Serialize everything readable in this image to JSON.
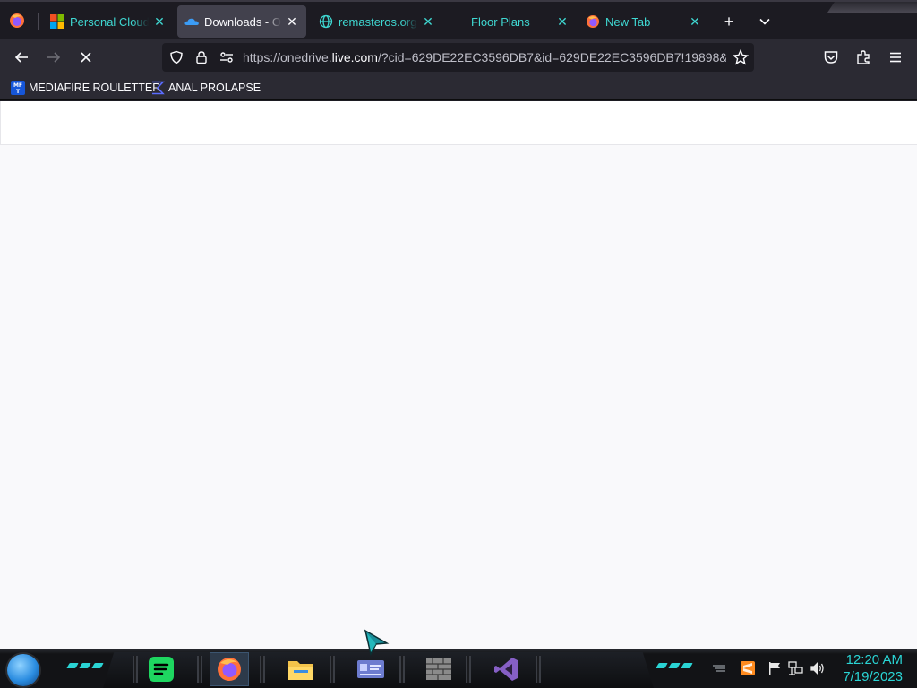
{
  "browser": {
    "tabs": [
      {
        "label": "Personal Cloud Storage",
        "icon": "microsoft-icon",
        "active": false
      },
      {
        "label": "Downloads - OneDrive",
        "icon": "onedrive-icon",
        "active": true
      },
      {
        "label": "remasteros.org/n",
        "icon": "globe-icon",
        "active": false
      },
      {
        "label": "Floor Plans",
        "icon": "none",
        "active": false
      },
      {
        "label": "New Tab",
        "icon": "firefox-icon",
        "active": false
      }
    ],
    "close_glyph": "✕",
    "new_tab_glyph": "+",
    "list_tabs_glyph": "⌄",
    "url": {
      "prefix": "https://onedrive.",
      "host": "live.com",
      "suffix": "/?cid=629DE22EC3596DB7&id=629DE22EC3596DB7!19898&"
    },
    "bookmarks": [
      {
        "label": "MEDIAFIRE ROULETTER",
        "icon": "mediafire-icon",
        "icon_text": "MF T"
      },
      {
        "label": "ANAL PROLAPSE",
        "icon": "bracket-icon"
      }
    ]
  },
  "taskbar": {
    "apps": [
      "spotify-icon",
      "firefox-icon",
      "file-explorer-icon",
      "id-card-icon",
      "firewall-icon",
      "visual-studio-icon"
    ],
    "clock": {
      "time": "12:20 AM",
      "date": "7/19/2023"
    }
  },
  "colors": {
    "accent": "#3fd8d2",
    "toolbar": "#2b2a33",
    "tabstrip": "#1c1b22",
    "active_tab": "#42414d",
    "taskbar_accent": "#2ad4d4",
    "content_bg": "#f9f9fb"
  }
}
